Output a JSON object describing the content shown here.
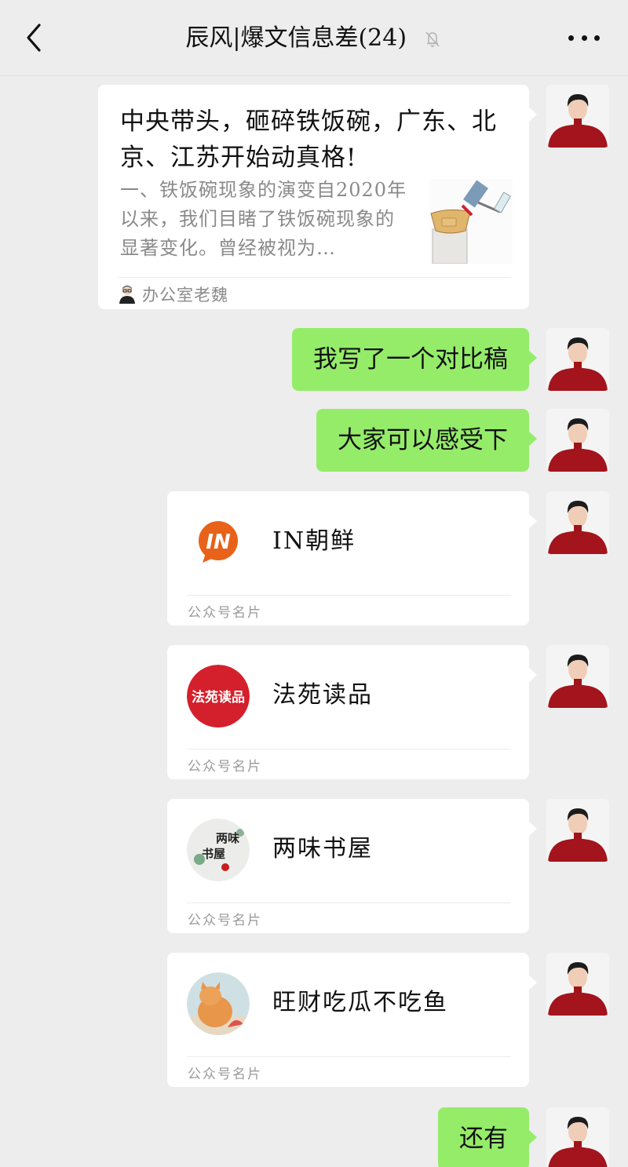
{
  "header": {
    "title": "辰风|爆文信息差(24)",
    "back_icon": "chevron-left-icon",
    "mute_icon": "bell-off-icon",
    "more_icon": "more-dots-icon"
  },
  "messages": [
    {
      "type": "article",
      "sender": "self",
      "title": "中央带头，砸碎铁饭碗，广东、北京、江苏开始动真格!",
      "description": "一、铁饭碗现象的演变自2020年以来，我们目睹了铁饭碗现象的显著变化。曾经被视为…",
      "source": "办公室老魏"
    },
    {
      "type": "text",
      "sender": "self",
      "text": "我写了一个对比稿"
    },
    {
      "type": "text",
      "sender": "self",
      "text": "大家可以感受下"
    },
    {
      "type": "contact-card",
      "sender": "self",
      "name": "IN朝鲜",
      "label": "公众号名片",
      "logo_text": "IN",
      "logo_color": "#e8621a"
    },
    {
      "type": "contact-card",
      "sender": "self",
      "name": "法苑读品",
      "label": "公众号名片",
      "logo_text": "法苑读品",
      "logo_color": "#d4202c"
    },
    {
      "type": "contact-card",
      "sender": "self",
      "name": "两味书屋",
      "label": "公众号名片",
      "logo_text_a": "两味",
      "logo_text_b": "书屋",
      "logo_color": "#ececea"
    },
    {
      "type": "contact-card",
      "sender": "self",
      "name": "旺财吃瓜不吃鱼",
      "label": "公众号名片",
      "logo_color": "#e8a25a"
    },
    {
      "type": "text",
      "sender": "self",
      "text": "还有"
    }
  ],
  "colors": {
    "background": "#ededed",
    "self_bubble": "#95ec69",
    "card_bubble": "#ffffff"
  }
}
